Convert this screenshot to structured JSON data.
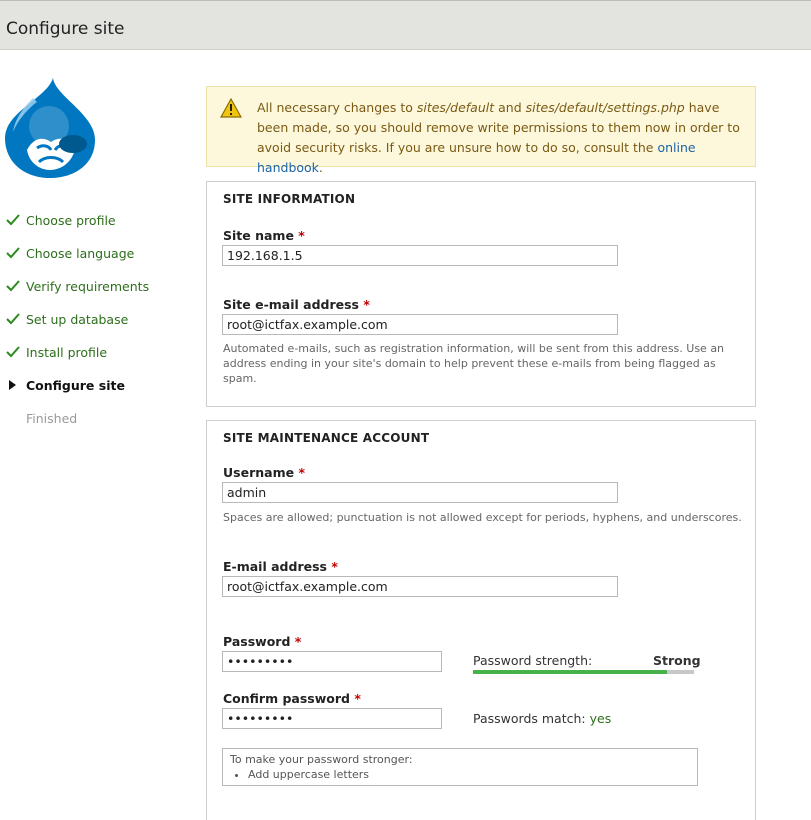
{
  "header": {
    "title": "Configure site"
  },
  "logo": {
    "icon": "drupal-drop-icon",
    "color": "#0077c0"
  },
  "steps": [
    {
      "label": "Choose profile",
      "state": "done"
    },
    {
      "label": "Choose language",
      "state": "done"
    },
    {
      "label": "Verify requirements",
      "state": "done"
    },
    {
      "label": "Set up database",
      "state": "done"
    },
    {
      "label": "Install profile",
      "state": "done"
    },
    {
      "label": "Configure site",
      "state": "active"
    },
    {
      "label": "Finished",
      "state": "future"
    }
  ],
  "warning": {
    "icon": "warning-triangle-icon",
    "text_1": "All necessary changes to ",
    "path_1": "sites/default",
    "text_2": " and ",
    "path_2": "sites/default/settings.php",
    "text_3": " have been made, so you should remove write permissions to them now in order to avoid security risks. If you are unsure how to do so, consult the ",
    "link": "online handbook",
    "text_4": "."
  },
  "site_info": {
    "legend": "SITE INFORMATION",
    "site_name": {
      "label": "Site name",
      "required": "*",
      "value": "192.168.1.5"
    },
    "site_email": {
      "label": "Site e-mail address",
      "required": "*",
      "value": "root@ictfax.example.com",
      "description": "Automated e-mails, such as registration information, will be sent from this address. Use an address ending in your site's domain to help prevent these e-mails from being flagged as spam."
    }
  },
  "account": {
    "legend": "SITE MAINTENANCE ACCOUNT",
    "username": {
      "label": "Username",
      "required": "*",
      "value": "admin",
      "description": "Spaces are allowed; punctuation is not allowed except for periods, hyphens, and underscores."
    },
    "email": {
      "label": "E-mail address",
      "required": "*",
      "value": "root@ictfax.example.com"
    },
    "password": {
      "label": "Password",
      "required": "*",
      "value": "•••••••••"
    },
    "strength": {
      "label": "Password strength:",
      "value": "Strong",
      "level": 0.88
    },
    "confirm": {
      "label": "Confirm password",
      "required": "*",
      "value": "•••••••••"
    },
    "match": {
      "label": "Passwords match:",
      "value": "yes"
    },
    "tips": {
      "title": "To make your password stronger:",
      "items": [
        "Add uppercase letters"
      ]
    }
  }
}
